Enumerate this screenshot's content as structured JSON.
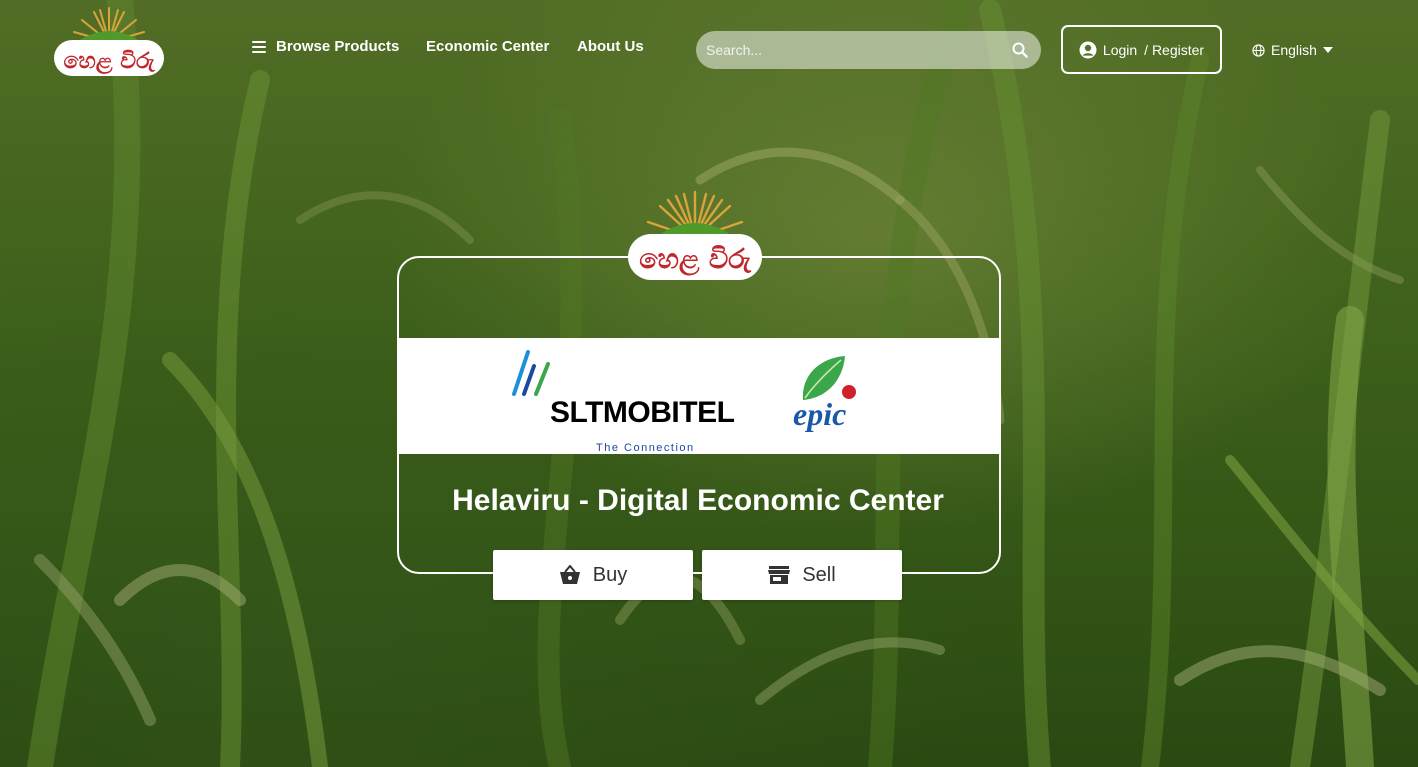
{
  "header": {
    "logo_alt": "හෙළ විරු",
    "nav": {
      "browse_products": "Browse Products",
      "economic_center": "Economic Center",
      "about_us": "About Us"
    },
    "search": {
      "placeholder": "Search..."
    },
    "auth": {
      "login": "Login",
      "register": "/ Register"
    },
    "language": {
      "selected": "English"
    }
  },
  "hero": {
    "partners": {
      "slt_name": "SLTMOBITEL",
      "slt_tagline": "The Connection",
      "epic_name": "epic"
    },
    "title": "Helaviru - Digital Economic Center",
    "buttons": {
      "buy": "Buy",
      "sell": "Sell"
    }
  },
  "colors": {
    "accent_green": "#3f6b1e",
    "slt_blue": "#1a4aa0",
    "slt_green": "#3aa84a",
    "logo_red": "#c0272d",
    "logo_gold": "#d9a43a"
  },
  "icons": {
    "hamburger": "menu-icon",
    "search": "search-icon",
    "user": "user-circle-icon",
    "globe": "globe-icon",
    "buy": "basket-icon",
    "sell": "store-icon"
  }
}
